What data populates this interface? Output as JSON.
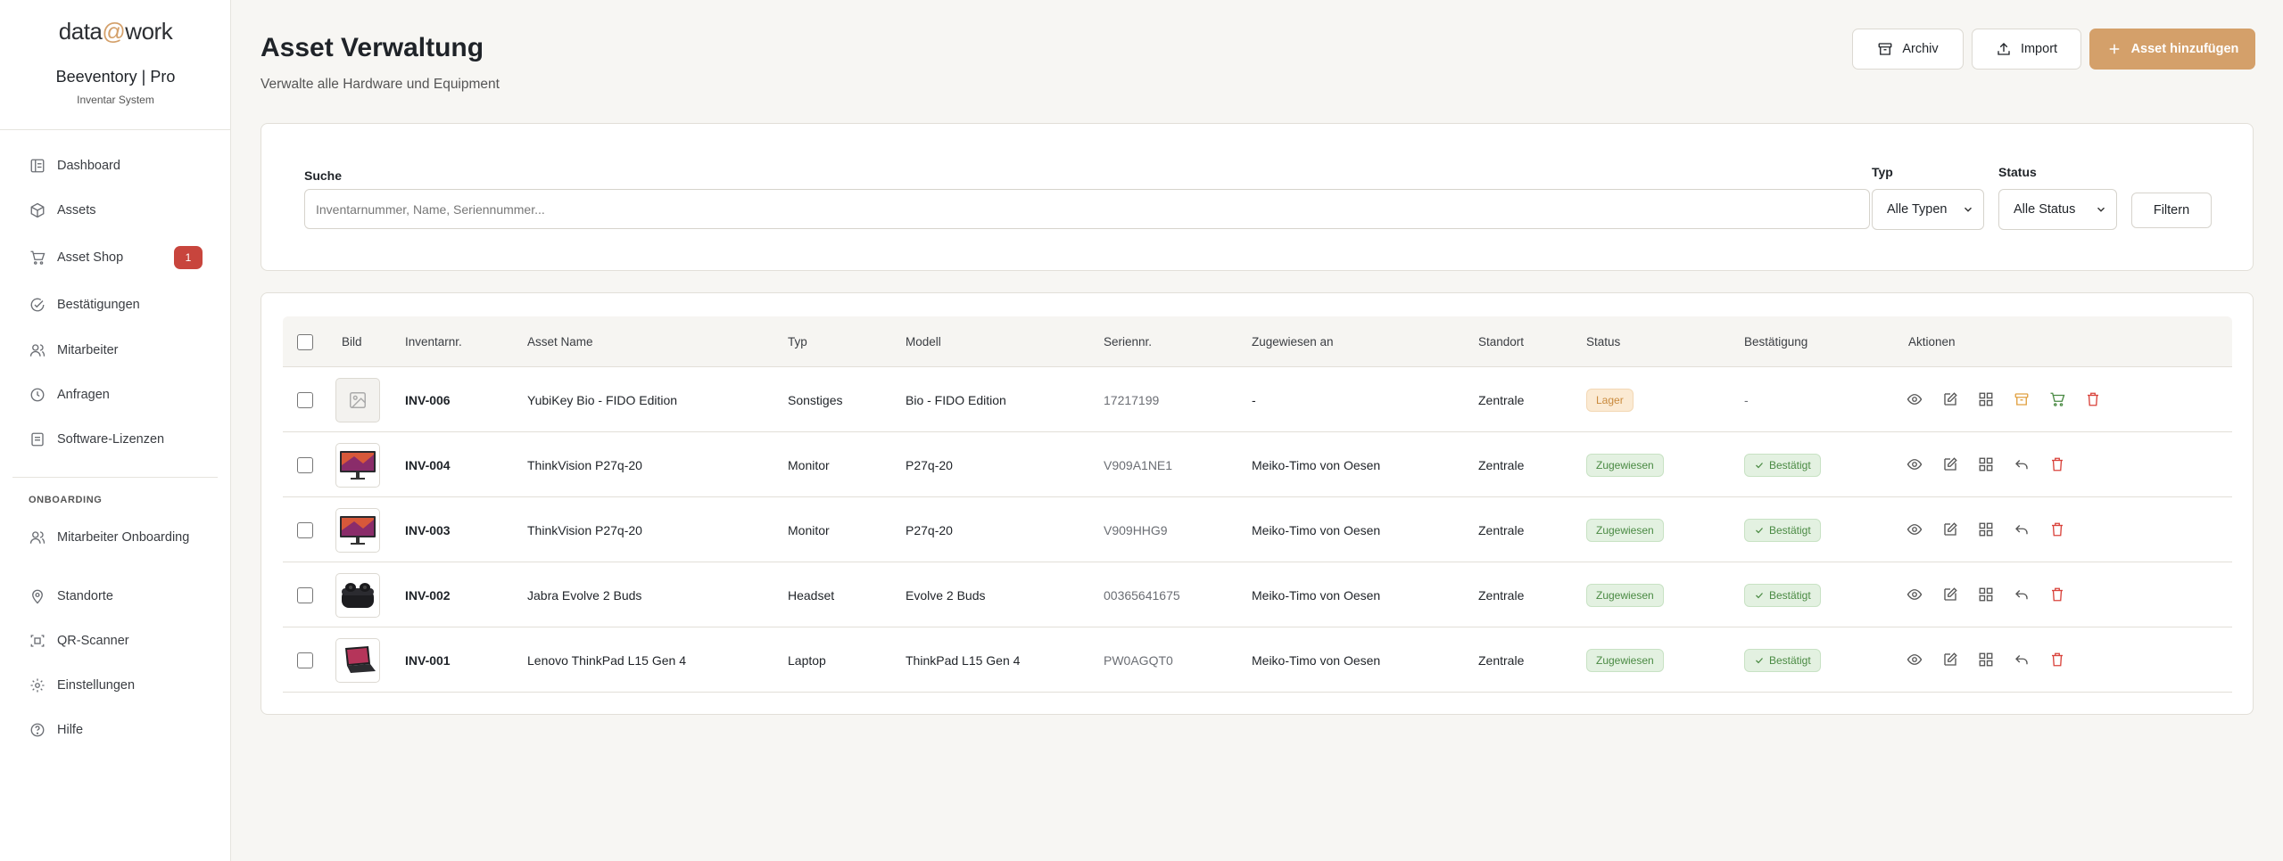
{
  "brand": {
    "logo_left": "data",
    "logo_at": "@",
    "logo_right": "work",
    "org_name": "Beeventory | Pro",
    "org_sub": "Inventar System"
  },
  "sidebar": {
    "items": [
      {
        "label": "Dashboard",
        "icon": "dashboard-icon"
      },
      {
        "label": "Assets",
        "icon": "box-icon"
      },
      {
        "label": "Asset Shop",
        "icon": "cart-icon",
        "badge": "1"
      },
      {
        "label": "Bestätigungen",
        "icon": "check-circle-icon"
      },
      {
        "label": "Mitarbeiter",
        "icon": "users-icon"
      },
      {
        "label": "Anfragen",
        "icon": "clock-icon"
      },
      {
        "label": "Software-Lizenzen",
        "icon": "license-icon"
      }
    ],
    "section_label": "ONBOARDING",
    "items2": [
      {
        "label": "Mitarbeiter Onboarding",
        "icon": "user-plus-icon"
      },
      {
        "label": "Standorte",
        "icon": "map-pin-icon"
      },
      {
        "label": "QR-Scanner",
        "icon": "qr-scan-icon"
      },
      {
        "label": "Einstellungen",
        "icon": "gear-icon"
      },
      {
        "label": "Hilfe",
        "icon": "help-icon"
      }
    ]
  },
  "header": {
    "title": "Asset Verwaltung",
    "subtitle": "Verwalte alle Hardware und Equipment",
    "archive_label": "Archiv",
    "import_label": "Import",
    "add_label": "Asset hinzufügen"
  },
  "filter": {
    "search_label": "Suche",
    "search_placeholder": "Inventarnummer, Name, Seriennummer...",
    "search_value": "",
    "type_label": "Typ",
    "type_value": "Alle Typen",
    "status_label": "Status",
    "status_value": "Alle Status",
    "filter_button": "Filtern"
  },
  "table": {
    "columns": [
      "Bild",
      "Inventarnr.",
      "Asset Name",
      "Typ",
      "Modell",
      "Seriennr.",
      "Zugewiesen an",
      "Standort",
      "Status",
      "Bestätigung",
      "Aktionen"
    ],
    "rows": [
      {
        "inv": "INV-006",
        "name": "YubiKey Bio - FIDO Edition",
        "type": "Sonstiges",
        "model": "Bio - FIDO Edition",
        "serial": "17217199",
        "assigned": "-",
        "location": "Zentrale",
        "status": "Lager",
        "confirmation": "-",
        "image": "placeholder"
      },
      {
        "inv": "INV-004",
        "name": "ThinkVision P27q-20",
        "type": "Monitor",
        "model": "P27q-20",
        "serial": "V909A1NE1",
        "assigned": "Meiko-Timo von Oesen",
        "location": "Zentrale",
        "status": "Zugewiesen",
        "confirmation": "Bestätigt",
        "image": "monitor"
      },
      {
        "inv": "INV-003",
        "name": "ThinkVision P27q-20",
        "type": "Monitor",
        "model": "P27q-20",
        "serial": "V909HHG9",
        "assigned": "Meiko-Timo von Oesen",
        "location": "Zentrale",
        "status": "Zugewiesen",
        "confirmation": "Bestätigt",
        "image": "monitor"
      },
      {
        "inv": "INV-002",
        "name": "Jabra Evolve 2 Buds",
        "type": "Headset",
        "model": "Evolve 2 Buds",
        "serial": "00365641675",
        "assigned": "Meiko-Timo von Oesen",
        "location": "Zentrale",
        "status": "Zugewiesen",
        "confirmation": "Bestätigt",
        "image": "earbuds"
      },
      {
        "inv": "INV-001",
        "name": "Lenovo ThinkPad L15 Gen 4",
        "type": "Laptop",
        "model": "ThinkPad L15 Gen 4",
        "serial": "PW0AGQT0",
        "assigned": "Meiko-Timo von Oesen",
        "location": "Zentrale",
        "status": "Zugewiesen",
        "confirmation": "Bestätigt",
        "image": "laptop"
      }
    ]
  },
  "colors": {
    "accent": "#d4a06a",
    "danger": "#d9423b",
    "success": "#4a8a43",
    "warning": "#e0a040"
  }
}
